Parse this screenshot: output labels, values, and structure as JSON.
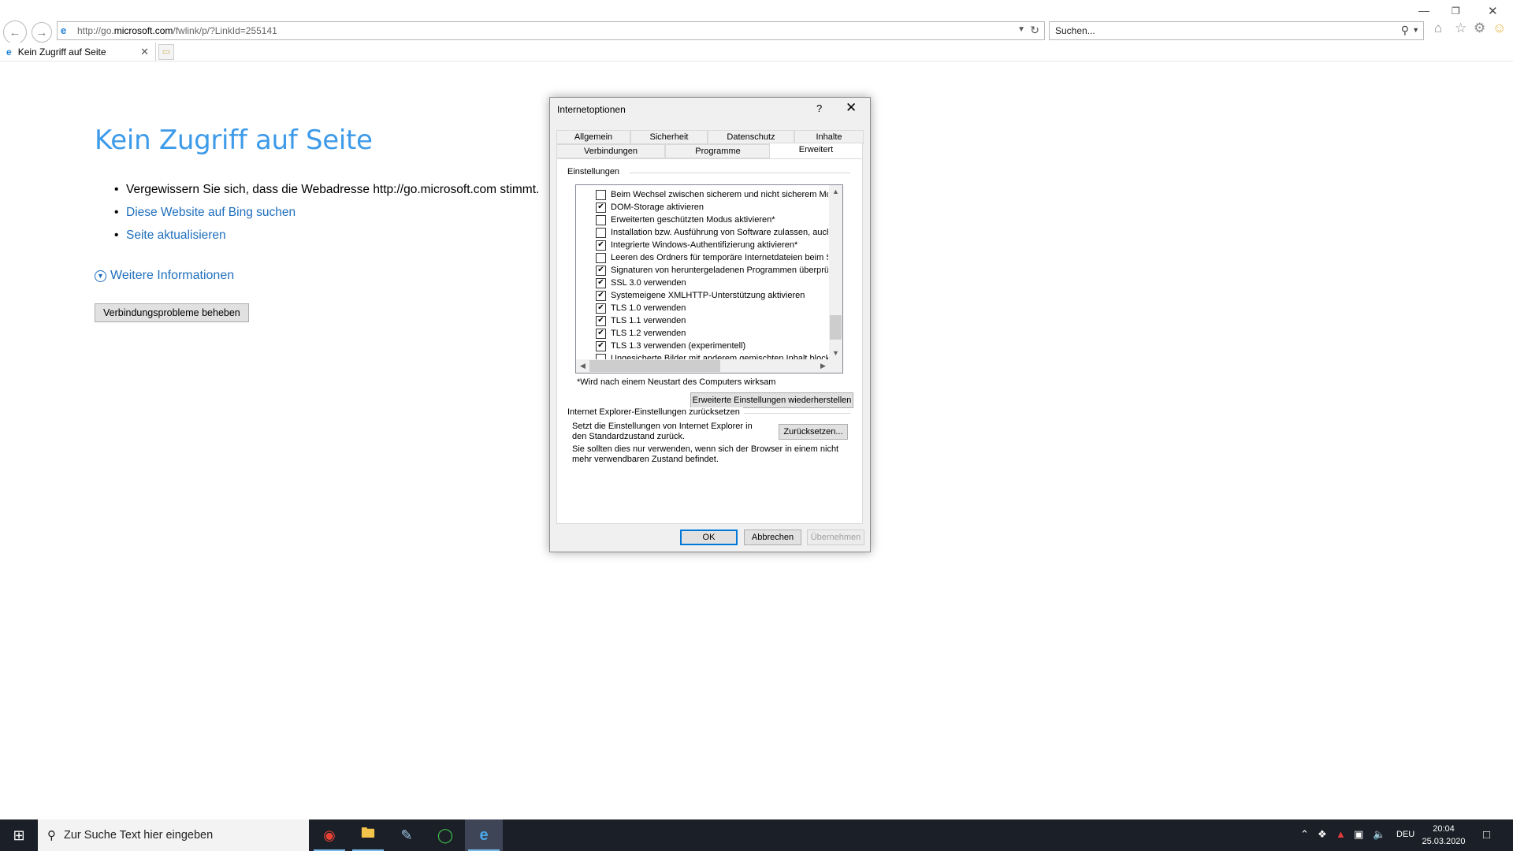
{
  "browser": {
    "url_prefix": "http://go.",
    "url_domain": "microsoft.com",
    "url_suffix": "/fwlink/p/?LinkId=255141",
    "search_placeholder": "Suchen...",
    "tab_title": "Kein Zugriff auf Seite"
  },
  "page": {
    "heading": "Kein Zugriff auf Seite",
    "bullets": [
      "Vergewissern Sie sich, dass die Webadresse http://go.microsoft.com stimmt.",
      "Diese Website auf Bing suchen",
      "Seite aktualisieren"
    ],
    "more_info": "Weitere Informationen",
    "fix_button": "Verbindungsprobleme beheben"
  },
  "dialog": {
    "title": "Internetoptionen",
    "help": "?",
    "tabs_top": [
      "Allgemein",
      "Sicherheit",
      "Datenschutz",
      "Inhalte"
    ],
    "tabs_bottom": [
      "Verbindungen",
      "Programme",
      "Erweitert"
    ],
    "active_tab": "Erweitert",
    "settings_group": "Einstellungen",
    "settings": [
      {
        "label": "Beim Wechsel zwischen sicherem und nicht sicherem Modu",
        "checked": false
      },
      {
        "label": "DOM-Storage aktivieren",
        "checked": true
      },
      {
        "label": "Erweiterten geschützten Modus aktivieren*",
        "checked": false
      },
      {
        "label": "Installation bzw. Ausführung von Software zulassen, auch",
        "checked": false
      },
      {
        "label": "Integrierte Windows-Authentifizierung aktivieren*",
        "checked": true
      },
      {
        "label": "Leeren des Ordners für temporäre Internetdateien beim S",
        "checked": false
      },
      {
        "label": "Signaturen von heruntergeladenen Programmen überprüfe",
        "checked": true
      },
      {
        "label": "SSL 3.0 verwenden",
        "checked": true
      },
      {
        "label": "Systemeigene XMLHTTP-Unterstützung aktivieren",
        "checked": true
      },
      {
        "label": "TLS 1.0 verwenden",
        "checked": true
      },
      {
        "label": "TLS 1.1 verwenden",
        "checked": true
      },
      {
        "label": "TLS 1.2 verwenden",
        "checked": true
      },
      {
        "label": "TLS 1.3 verwenden (experimentell)",
        "checked": true
      },
      {
        "label": "Ungesicherte Bilder mit anderem gemischten Inhalt blockie",
        "checked": false
      }
    ],
    "restart_note": "*Wird nach einem Neustart des Computers wirksam",
    "restore_button": "Erweiterte Einstellungen wiederherstellen",
    "reset_group": "Internet Explorer-Einstellungen zurücksetzen",
    "reset_text": "Setzt die Einstellungen von Internet Explorer in den Standardzustand zurück.",
    "reset_button": "Zurücksetzen...",
    "reset_warning": "Sie sollten dies nur verwenden, wenn sich der Browser in einem nicht mehr verwendbaren Zustand befindet.",
    "ok": "OK",
    "cancel": "Abbrechen",
    "apply": "Übernehmen"
  },
  "taskbar": {
    "search_placeholder": "Zur Suche Text hier eingeben",
    "language": "DEU",
    "time": "20:04",
    "date": "25.03.2020"
  }
}
